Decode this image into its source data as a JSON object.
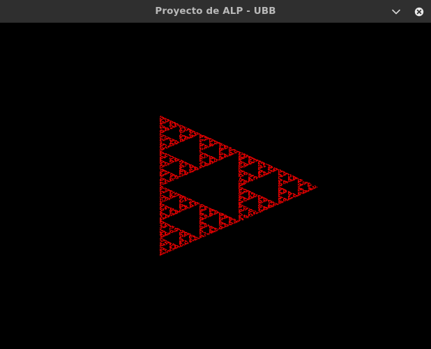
{
  "window": {
    "title": "Proyecto de ALP - UBB",
    "minimize_icon": "chevron-down-icon",
    "close_icon": "close-icon"
  },
  "colors": {
    "titlebar_bg": "#2f2f2f",
    "title_text": "#b9b9b9",
    "canvas_bg": "#000000",
    "fractal_points": "#d40000"
  },
  "canvas": {
    "content": "sierpinski-triangle-fractal",
    "orientation": "pointing-right"
  }
}
